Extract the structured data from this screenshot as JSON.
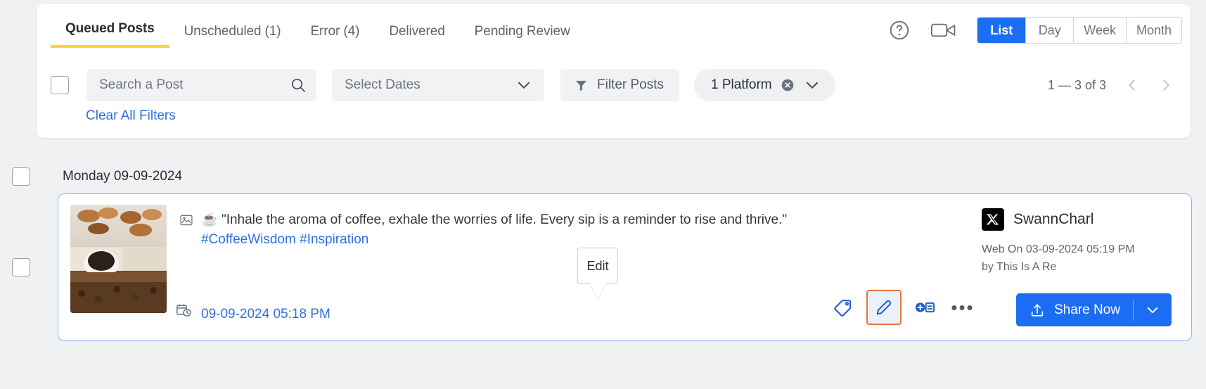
{
  "tabs": [
    {
      "label": "Queued Posts",
      "active": true
    },
    {
      "label": "Unscheduled (1)",
      "active": false
    },
    {
      "label": "Error (4)",
      "active": false
    },
    {
      "label": "Delivered",
      "active": false
    },
    {
      "label": "Pending Review",
      "active": false
    }
  ],
  "header_icons": {
    "help": "help-circle-icon",
    "video": "video-camera-icon"
  },
  "view_modes": [
    {
      "label": "List",
      "selected": true
    },
    {
      "label": "Day",
      "selected": false
    },
    {
      "label": "Week",
      "selected": false
    },
    {
      "label": "Month",
      "selected": false
    }
  ],
  "filters": {
    "search_placeholder": "Search a Post",
    "search_value": "",
    "dates_placeholder": "Select Dates",
    "filter_posts_label": "Filter Posts",
    "platform_chip_label": "1 Platform",
    "clear_all_label": "Clear All Filters"
  },
  "pagination": {
    "range": "1 — 3 of 3",
    "prev": "chevron-left-icon",
    "next": "chevron-right-icon"
  },
  "groups": [
    {
      "date_label": "Monday 09-09-2024",
      "posts": [
        {
          "text": "\"Inhale the aroma of coffee, exhale the worries of life. Every sip is a reminder to rise and thrive.\"",
          "emoji": "☕",
          "hashtags": "#CoffeeWisdom #Inspiration",
          "scheduled_time": "09-09-2024 05:18 PM",
          "account": {
            "platform": "X",
            "name": "SwannCharl",
            "meta_line1": "Web On 03-09-2024 05:19 PM",
            "meta_line2": "by This Is A Re"
          },
          "actions": {
            "tag": "tag-icon",
            "edit": "pencil-edit-icon",
            "duplicate": "duplicate-post-icon",
            "more": "more-options-icon",
            "share_label": "Share Now",
            "share_caret": "chevron-down-icon"
          },
          "tooltip": "Edit"
        }
      ]
    }
  ],
  "colors": {
    "accent_blue": "#1b6ef3",
    "link_blue": "#2f6fe0",
    "tab_underline": "#ffd43b",
    "edit_highlight": "#e8743b",
    "card_border": "#93b4e4"
  }
}
